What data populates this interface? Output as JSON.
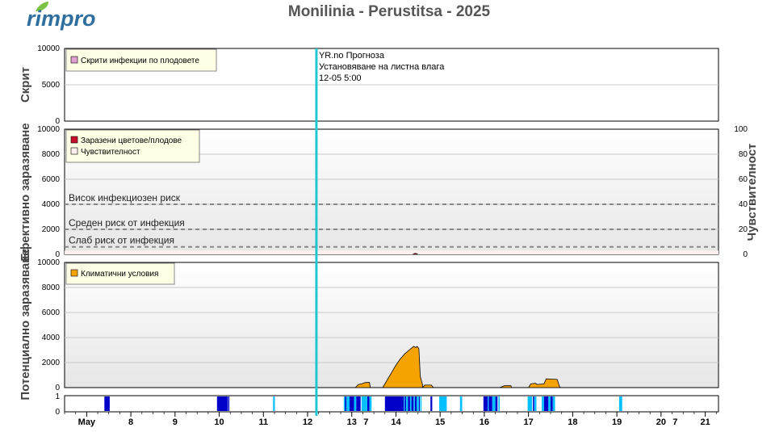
{
  "logo": {
    "text": "rimpro",
    "leaf_color": "#7cc242",
    "text_color": "#2f6f9f"
  },
  "title": "Monilinia - Perustitsa - 2025",
  "forecast": {
    "source": "YR.no Прогноза",
    "text": "Установяване на листна влага",
    "datetime": "12-05 5:00",
    "line_color": "#1fc7d4",
    "x_day": 12.2
  },
  "colors": {
    "hidden": "#e0a0d0",
    "infected": "#c8102e",
    "sensitivity": "#fff0f0",
    "climate": "#f5a300",
    "wet_dark": "#0000c8",
    "wet_light": "#00bfff",
    "legend_bg": "#ffffe6"
  },
  "x_axis": {
    "day_start": 6.5,
    "day_end": 21.3,
    "labels": [
      {
        "day": 7.0,
        "text": "May"
      },
      {
        "day": 8.0,
        "text": "8"
      },
      {
        "day": 9.0,
        "text": "9"
      },
      {
        "day": 10.0,
        "text": "10"
      },
      {
        "day": 11.0,
        "text": "11"
      },
      {
        "day": 12.0,
        "text": "12"
      },
      {
        "day": 13.0,
        "text": "13"
      },
      {
        "day": 13.32,
        "text": "7"
      },
      {
        "day": 14.0,
        "text": "14"
      },
      {
        "day": 15.0,
        "text": "15"
      },
      {
        "day": 16.0,
        "text": "16"
      },
      {
        "day": 17.0,
        "text": "17"
      },
      {
        "day": 18.0,
        "text": "18"
      },
      {
        "day": 19.0,
        "text": "19"
      },
      {
        "day": 20.0,
        "text": "20"
      },
      {
        "day": 20.32,
        "text": "7"
      },
      {
        "day": 21.0,
        "text": "21"
      }
    ]
  },
  "chart_data": [
    {
      "type": "area",
      "name": "panel-hidden",
      "ylabel": "Скрит",
      "ylim": [
        0,
        10000
      ],
      "yticks": [
        "0",
        "5000",
        "10000"
      ],
      "legend": [
        "Скрити инфекции по плодовете"
      ],
      "series": []
    },
    {
      "type": "area",
      "name": "panel-effective",
      "ylabel": "Ефективно заразяване",
      "y2label": "Чувствителност",
      "ylim": [
        0,
        10000
      ],
      "y2lim": [
        0,
        100
      ],
      "yticks": [
        "0",
        "2000",
        "4000",
        "6000",
        "8000",
        "10000"
      ],
      "y2ticks": [
        "0",
        "20",
        "40",
        "60",
        "80",
        "100"
      ],
      "legend": [
        "Заразени цветове/плодове",
        "Чувствителност"
      ],
      "thresholds": [
        {
          "label": "Висок инфекциозен риск",
          "value": 4000
        },
        {
          "label": "Среден риск от инфекция",
          "value": 2000
        },
        {
          "label": "Слаб риск от инфекция",
          "value": 600
        }
      ],
      "sensitivity_level": 3,
      "series": [
        {
          "name": "Заразени цветове/плодове",
          "x": [
            14.38,
            14.42,
            14.46,
            14.5
          ],
          "y": [
            0,
            80,
            80,
            0
          ]
        }
      ]
    },
    {
      "type": "area",
      "name": "panel-climate",
      "ylabel": "Потенциално заразяване",
      "ylim": [
        0,
        10000
      ],
      "yticks": [
        "0",
        "2000",
        "4000",
        "6000",
        "8000",
        "10000"
      ],
      "legend": [
        "Климатични условия"
      ],
      "series": [
        {
          "name": "Климатични условия",
          "x": [
            13.0,
            13.08,
            13.15,
            13.22,
            13.3,
            13.4,
            13.42,
            13.7,
            13.8,
            13.9,
            14.0,
            14.1,
            14.2,
            14.3,
            14.4,
            14.45,
            14.48,
            14.52,
            14.55,
            14.6,
            14.6,
            14.65,
            14.8,
            14.85,
            14.85,
            16.35,
            16.45,
            16.6,
            16.62,
            17.0,
            17.05,
            17.15,
            17.2,
            17.35,
            17.4,
            17.65,
            17.7,
            17.72
          ],
          "y": [
            0,
            0,
            250,
            300,
            400,
            420,
            0,
            0,
            600,
            1200,
            1800,
            2300,
            2700,
            3000,
            3300,
            3200,
            3300,
            3100,
            900,
            250,
            0,
            200,
            200,
            0,
            0,
            0,
            150,
            150,
            0,
            0,
            300,
            350,
            250,
            300,
            700,
            650,
            100,
            0
          ]
        }
      ]
    },
    {
      "type": "heatmap",
      "name": "panel-wetness",
      "ylim": [
        0,
        1
      ],
      "yticks": [
        "0",
        "1"
      ],
      "series": [
        {
          "name": "dark",
          "intervals": [
            [
              7.4,
              7.52
            ],
            [
              9.95,
              10.2
            ],
            [
              10.21,
              10.23
            ],
            [
              12.85,
              12.88
            ],
            [
              12.95,
              13.05
            ],
            [
              13.1,
              13.2
            ],
            [
              13.35,
              13.4
            ],
            [
              13.75,
              14.18
            ],
            [
              14.2,
              14.23
            ],
            [
              14.27,
              14.32
            ],
            [
              14.35,
              14.4
            ],
            [
              14.43,
              14.47
            ],
            [
              14.52,
              14.54
            ],
            [
              14.78,
              14.82
            ],
            [
              15.98,
              16.08
            ],
            [
              16.1,
              16.18
            ],
            [
              16.25,
              16.3
            ],
            [
              17.1,
              17.13
            ],
            [
              17.35,
              17.45
            ],
            [
              17.5,
              17.55
            ]
          ]
        },
        {
          "name": "light",
          "intervals": [
            [
              11.22,
              11.26
            ],
            [
              12.82,
              12.85
            ],
            [
              12.88,
              12.95
            ],
            [
              13.05,
              13.1
            ],
            [
              13.22,
              13.35
            ],
            [
              13.4,
              13.45
            ],
            [
              14.18,
              14.2
            ],
            [
              14.23,
              14.27
            ],
            [
              14.32,
              14.35
            ],
            [
              14.4,
              14.43
            ],
            [
              14.47,
              14.52
            ],
            [
              14.55,
              14.58
            ],
            [
              14.98,
              15.15
            ],
            [
              15.45,
              15.5
            ],
            [
              16.08,
              16.1
            ],
            [
              16.18,
              16.25
            ],
            [
              16.32,
              16.35
            ],
            [
              16.98,
              17.08
            ],
            [
              17.13,
              17.18
            ],
            [
              17.3,
              17.35
            ],
            [
              17.45,
              17.5
            ],
            [
              17.55,
              17.6
            ],
            [
              19.05,
              19.12
            ]
          ]
        }
      ]
    }
  ]
}
